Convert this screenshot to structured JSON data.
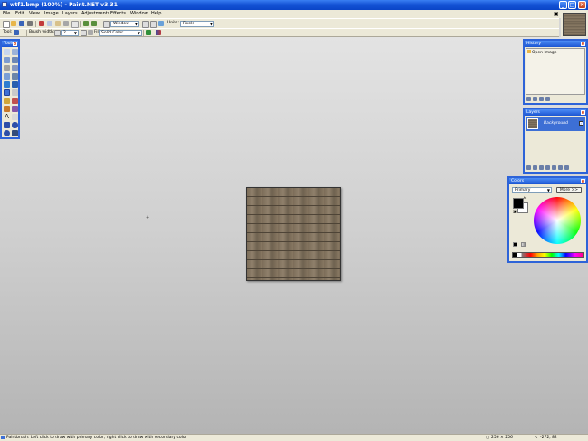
{
  "window": {
    "title": "wtf1.bmp (100%) - Paint.NET v3.31"
  },
  "menu": [
    "File",
    "Edit",
    "View",
    "Image",
    "Layers",
    "Adjustments",
    "Effects",
    "Window",
    "Help"
  ],
  "toolbar": {
    "zoom_value": "Window",
    "units_label": "Units:",
    "units_value": "Pixels"
  },
  "tool_options": {
    "tool_label": "Tool:",
    "brush_width_label": "Brush width:",
    "brush_width_value": "2",
    "fill_label": "Fill:",
    "fill_value": "Solid Color"
  },
  "panels": {
    "tools_title": "Tools",
    "history_title": "History",
    "history_items": [
      "Open Image"
    ],
    "layers_title": "Layers",
    "layer_name": "Background",
    "colors_title": "Colors",
    "colors_mode": "Primary",
    "colors_more": "More >>"
  },
  "status": {
    "hint": "Paintbrush: Left click to draw with primary color, right click to draw with secondary color",
    "image_size": "256 × 256",
    "cursor_pos": "-272, 82"
  },
  "colors": {
    "primary": "#000000",
    "secondary": "#ffffff",
    "accent": "#2d63d8"
  }
}
